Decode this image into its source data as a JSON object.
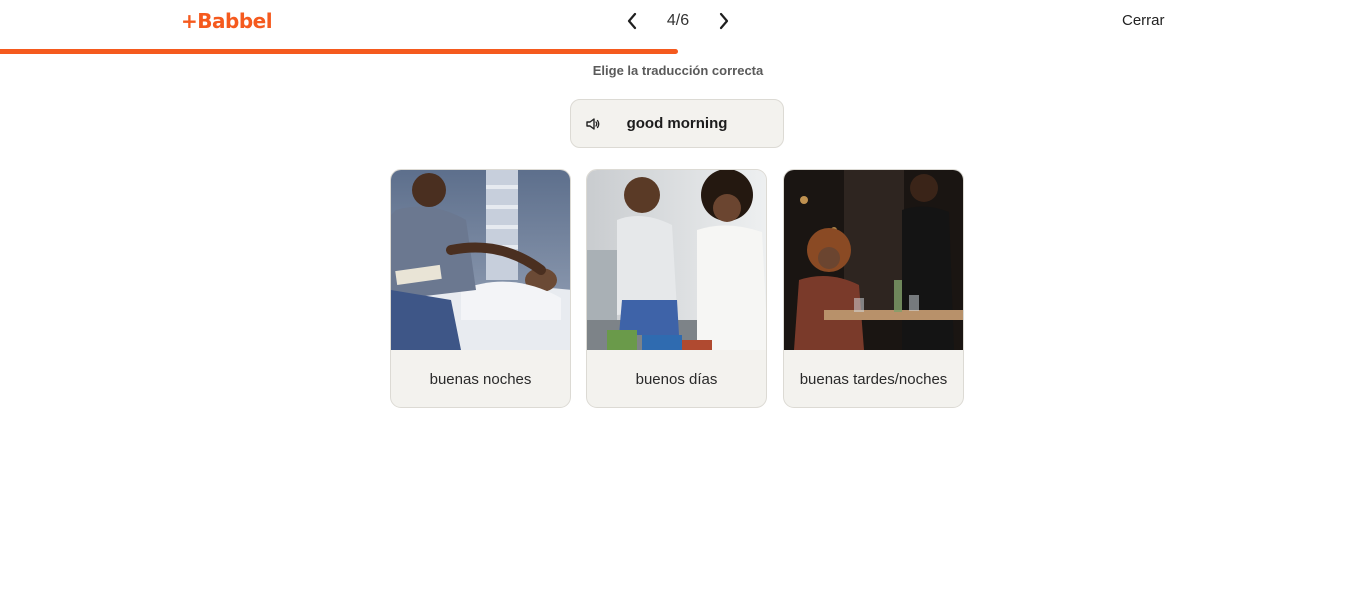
{
  "header": {
    "logo": "+Babbel",
    "counter": "4/6",
    "close_label": "Cerrar"
  },
  "progress": {
    "fraction": 0.5
  },
  "exercise": {
    "instruction": "Elige la traducción correcta",
    "prompt": "good morning"
  },
  "options": [
    {
      "label": "buenas noches"
    },
    {
      "label": "buenos días"
    },
    {
      "label": "buenas tardes/noches"
    }
  ],
  "colors": {
    "accent": "#f55a1e",
    "card_bg": "#f3f2ee"
  },
  "icons": {
    "prev": "chevron-left-icon",
    "next": "chevron-right-icon",
    "audio": "speaker-icon"
  }
}
